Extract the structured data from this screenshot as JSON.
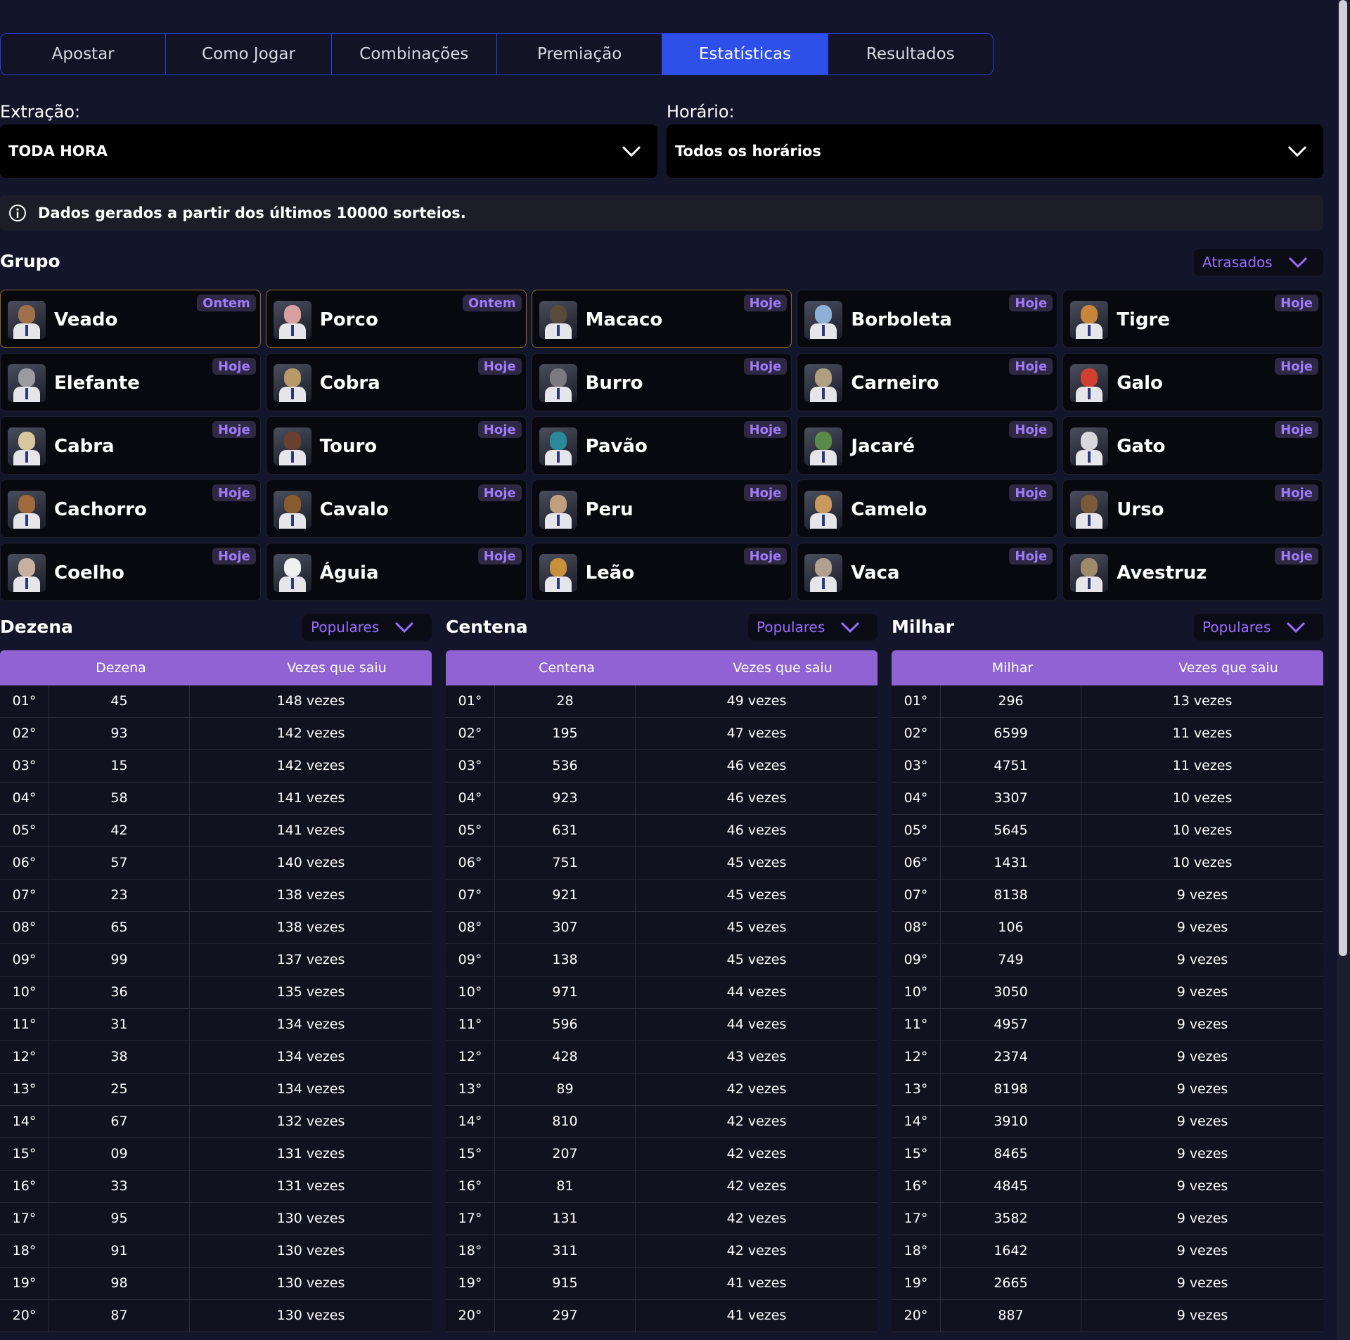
{
  "tabs": [
    "Apostar",
    "Como Jogar",
    "Combinações",
    "Premiação",
    "Estatísticas",
    "Resultados"
  ],
  "active_tab": "Estatísticas",
  "filters": {
    "extracao_label": "Extração:",
    "extracao_value": "TODA HORA",
    "horario_label": "Horário:",
    "horario_value": "Todos os horários"
  },
  "info_text": "Dados gerados a partir dos últimos 10000 sorteios.",
  "grupo": {
    "title": "Grupo",
    "sort_label": "Atrasados",
    "animals": [
      {
        "name": "Veado",
        "badge": "Ontem",
        "color": "#a0704a"
      },
      {
        "name": "Porco",
        "badge": "Ontem",
        "color": "#d9a0a0"
      },
      {
        "name": "Macaco",
        "badge": "Hoje",
        "color": "#5a4a3a"
      },
      {
        "name": "Borboleta",
        "badge": "Hoje",
        "color": "#8fb0d8"
      },
      {
        "name": "Tigre",
        "badge": "Hoje",
        "color": "#c8863a"
      },
      {
        "name": "Elefante",
        "badge": "Hoje",
        "color": "#9a9aa0"
      },
      {
        "name": "Cobra",
        "badge": "Hoje",
        "color": "#b89a6a"
      },
      {
        "name": "Burro",
        "badge": "Hoje",
        "color": "#7a7a80"
      },
      {
        "name": "Carneiro",
        "badge": "Hoje",
        "color": "#b0a080"
      },
      {
        "name": "Galo",
        "badge": "Hoje",
        "color": "#d04030"
      },
      {
        "name": "Cabra",
        "badge": "Hoje",
        "color": "#d8c8a0"
      },
      {
        "name": "Touro",
        "badge": "Hoje",
        "color": "#6a4030"
      },
      {
        "name": "Pavão",
        "badge": "Hoje",
        "color": "#2a8a9a"
      },
      {
        "name": "Jacaré",
        "badge": "Hoje",
        "color": "#5a8a4a"
      },
      {
        "name": "Gato",
        "badge": "Hoje",
        "color": "#d8d8dc"
      },
      {
        "name": "Cachorro",
        "badge": "Hoje",
        "color": "#a06a3a"
      },
      {
        "name": "Cavalo",
        "badge": "Hoje",
        "color": "#8a5a30"
      },
      {
        "name": "Peru",
        "badge": "Hoje",
        "color": "#c0a080"
      },
      {
        "name": "Camelo",
        "badge": "Hoje",
        "color": "#c89a60"
      },
      {
        "name": "Urso",
        "badge": "Hoje",
        "color": "#7a5a3a"
      },
      {
        "name": "Coelho",
        "badge": "Hoje",
        "color": "#c8b0a0"
      },
      {
        "name": "Águia",
        "badge": "Hoje",
        "color": "#f0f0f0"
      },
      {
        "name": "Leão",
        "badge": "Hoje",
        "color": "#c8903a"
      },
      {
        "name": "Vaca",
        "badge": "Hoje",
        "color": "#b0a090"
      },
      {
        "name": "Avestruz",
        "badge": "Hoje",
        "color": "#a08a6a"
      }
    ]
  },
  "tables": [
    {
      "title": "Dezena",
      "sort_label": "Populares",
      "col1": "Dezena",
      "col2": "Vezes que saiu",
      "rows": [
        [
          "01°",
          "45",
          "148 vezes"
        ],
        [
          "02°",
          "93",
          "142 vezes"
        ],
        [
          "03°",
          "15",
          "142 vezes"
        ],
        [
          "04°",
          "58",
          "141 vezes"
        ],
        [
          "05°",
          "42",
          "141 vezes"
        ],
        [
          "06°",
          "57",
          "140 vezes"
        ],
        [
          "07°",
          "23",
          "138 vezes"
        ],
        [
          "08°",
          "65",
          "138 vezes"
        ],
        [
          "09°",
          "99",
          "137 vezes"
        ],
        [
          "10°",
          "36",
          "135 vezes"
        ],
        [
          "11°",
          "31",
          "134 vezes"
        ],
        [
          "12°",
          "38",
          "134 vezes"
        ],
        [
          "13°",
          "25",
          "134 vezes"
        ],
        [
          "14°",
          "67",
          "132 vezes"
        ],
        [
          "15°",
          "09",
          "131 vezes"
        ],
        [
          "16°",
          "33",
          "131 vezes"
        ],
        [
          "17°",
          "95",
          "130 vezes"
        ],
        [
          "18°",
          "91",
          "130 vezes"
        ],
        [
          "19°",
          "98",
          "130 vezes"
        ],
        [
          "20°",
          "87",
          "130 vezes"
        ]
      ]
    },
    {
      "title": "Centena",
      "sort_label": "Populares",
      "col1": "Centena",
      "col2": "Vezes que saiu",
      "rows": [
        [
          "01°",
          "28",
          "49 vezes"
        ],
        [
          "02°",
          "195",
          "47 vezes"
        ],
        [
          "03°",
          "536",
          "46 vezes"
        ],
        [
          "04°",
          "923",
          "46 vezes"
        ],
        [
          "05°",
          "631",
          "46 vezes"
        ],
        [
          "06°",
          "751",
          "45 vezes"
        ],
        [
          "07°",
          "921",
          "45 vezes"
        ],
        [
          "08°",
          "307",
          "45 vezes"
        ],
        [
          "09°",
          "138",
          "45 vezes"
        ],
        [
          "10°",
          "971",
          "44 vezes"
        ],
        [
          "11°",
          "596",
          "44 vezes"
        ],
        [
          "12°",
          "428",
          "43 vezes"
        ],
        [
          "13°",
          "89",
          "42 vezes"
        ],
        [
          "14°",
          "810",
          "42 vezes"
        ],
        [
          "15°",
          "207",
          "42 vezes"
        ],
        [
          "16°",
          "81",
          "42 vezes"
        ],
        [
          "17°",
          "131",
          "42 vezes"
        ],
        [
          "18°",
          "311",
          "42 vezes"
        ],
        [
          "19°",
          "915",
          "41 vezes"
        ],
        [
          "20°",
          "297",
          "41 vezes"
        ]
      ]
    },
    {
      "title": "Milhar",
      "sort_label": "Populares",
      "col1": "Milhar",
      "col2": "Vezes que saiu",
      "rows": [
        [
          "01°",
          "296",
          "13 vezes"
        ],
        [
          "02°",
          "6599",
          "11 vezes"
        ],
        [
          "03°",
          "4751",
          "11 vezes"
        ],
        [
          "04°",
          "3307",
          "10 vezes"
        ],
        [
          "05°",
          "5645",
          "10 vezes"
        ],
        [
          "06°",
          "1431",
          "10 vezes"
        ],
        [
          "07°",
          "8138",
          "9 vezes"
        ],
        [
          "08°",
          "106",
          "9 vezes"
        ],
        [
          "09°",
          "749",
          "9 vezes"
        ],
        [
          "10°",
          "3050",
          "9 vezes"
        ],
        [
          "11°",
          "4957",
          "9 vezes"
        ],
        [
          "12°",
          "2374",
          "9 vezes"
        ],
        [
          "13°",
          "8198",
          "9 vezes"
        ],
        [
          "14°",
          "3910",
          "9 vezes"
        ],
        [
          "15°",
          "8465",
          "9 vezes"
        ],
        [
          "16°",
          "4845",
          "9 vezes"
        ],
        [
          "17°",
          "3582",
          "9 vezes"
        ],
        [
          "18°",
          "1642",
          "9 vezes"
        ],
        [
          "19°",
          "2665",
          "9 vezes"
        ],
        [
          "20°",
          "887",
          "9 vezes"
        ]
      ]
    }
  ]
}
